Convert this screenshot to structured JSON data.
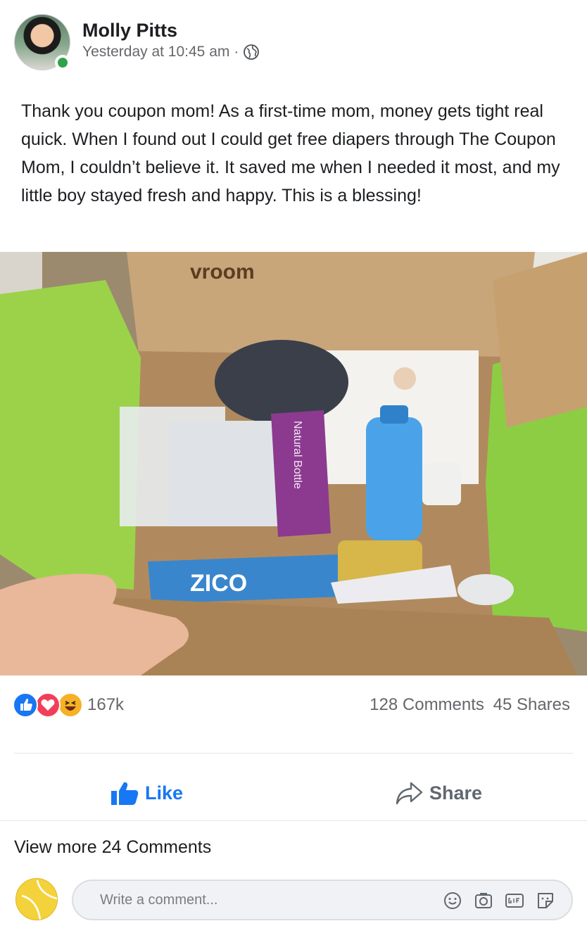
{
  "post": {
    "author": "Molly Pitts",
    "timestamp": "Yesterday at 10:45 am",
    "separator": "·",
    "privacy_icon": "globe-icon",
    "text": "Thank you coupon mom! As a first-time mom, money gets tight real quick. When I found out I could get free diapers through The Coupon Mom, I couldn’t believe it. It saved me when I needed it most, and my little boy stayed fresh and happy. This is a blessing!",
    "photo": {
      "box_brand": "vroom",
      "bottle_label": "Natural Bottle",
      "tube_label": "ZICO"
    }
  },
  "stats": {
    "reactions": [
      "like",
      "love",
      "haha"
    ],
    "reaction_count": "167k",
    "comments": "128 Comments",
    "shares": "45 Shares"
  },
  "actions": {
    "like_label": "Like",
    "share_label": "Share"
  },
  "comments": {
    "view_more": "View more 24 Comments",
    "placeholder": "Write a comment..."
  },
  "colors": {
    "accent": "#1877f2",
    "online": "#31a24c",
    "love": "#f33e58",
    "haha": "#f7b125"
  }
}
